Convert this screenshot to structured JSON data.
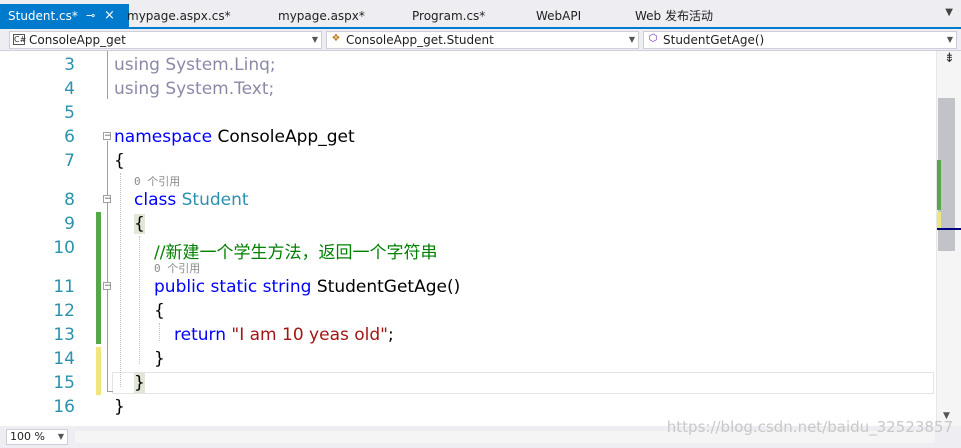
{
  "tabs": [
    {
      "label": "Student.cs*",
      "active": true,
      "pin": "⊸",
      "close": "×"
    },
    {
      "label": "mypage.aspx.cs*"
    },
    {
      "label": "mypage.aspx*"
    },
    {
      "label": "Program.cs*"
    },
    {
      "label": "WebAPI"
    },
    {
      "label": "Web 发布活动"
    }
  ],
  "tab_overflow_icon": "chevron-down-icon",
  "navbar": {
    "project": "ConsoleApp_get",
    "type": "ConsoleApp_get.Student",
    "member": "StudentGetAge()"
  },
  "code": {
    "line_numbers": [
      "3",
      "4",
      "5",
      "6",
      "7",
      "8",
      "9",
      "10",
      "11",
      "12",
      "13",
      "14",
      "15",
      "16"
    ],
    "using_kw": "using",
    "using1": " System.Linq;",
    "using2": " System.Text;",
    "namespace_kw": "namespace",
    "namespace_name": " ConsoleApp_get",
    "open_brace": "{",
    "lens_class": "0 个引用",
    "class_kw": "class",
    "class_name": " Student",
    "comment": "//新建一个学生方法，返回一个字符串",
    "lens_method": "0 个引用",
    "public_kw": "public",
    "static_kw": " static",
    "string_kw": " string",
    "method_sig": " StudentGetAge()",
    "return_kw": "return",
    "string_literal": "\"I am 10 yeas old\"",
    "semicolon": ";",
    "close_brace": "}"
  },
  "zoom": "100 %",
  "watermark": "https://blog.csdn.net/baidu_32523857",
  "colors": {
    "accent": "#007acc",
    "keyword": "#0000ff",
    "type": "#2b91af",
    "string": "#a31515",
    "comment": "#008000",
    "change_saved": "#57a64a",
    "change_unsaved": "#efe680"
  }
}
